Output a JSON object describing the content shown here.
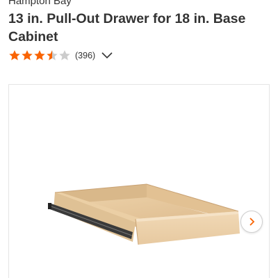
{
  "product": {
    "brand": "Hampton Bay",
    "title": "13 in. Pull-Out Drawer for 18 in. Base Cabinet"
  },
  "rating": {
    "value": 3.5,
    "max": 5,
    "review_count": "(396)",
    "icon": "chevron-down-icon"
  },
  "gallery": {
    "next_icon": "chevron-right-icon",
    "accent_color": "#f96302"
  },
  "colors": {
    "star_filled": "#f96302",
    "star_empty": "#cccccc",
    "text": "#333333"
  }
}
